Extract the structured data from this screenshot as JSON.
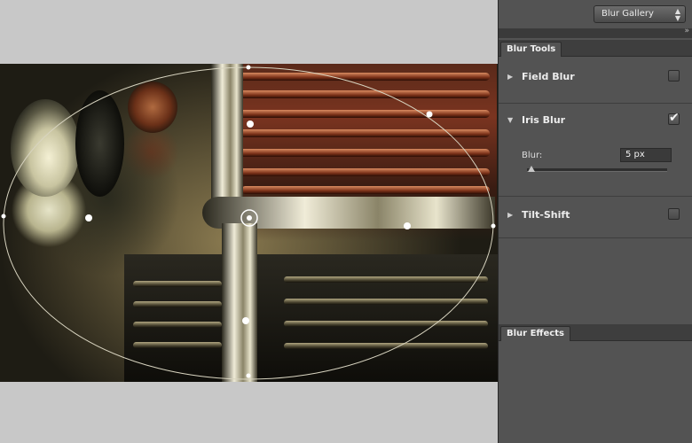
{
  "canvas": {
    "background": "#c8c8c8",
    "iris_overlay": {
      "stroke": "#d8d4c0",
      "handle_color": "#ffffff"
    }
  },
  "header": {
    "workspace_dropdown": {
      "value": "Blur Gallery",
      "caret_icon": "chevron-down-icon"
    },
    "collapse_icon": "double-chevron-right-icon"
  },
  "blur_tools": {
    "tab_label": "Blur Tools",
    "sections": [
      {
        "label": "Field Blur",
        "expanded": false,
        "checked": false
      },
      {
        "label": "Iris Blur",
        "expanded": true,
        "checked": true,
        "blur_label": "Blur:",
        "blur_value": "5 px",
        "slider_level": 0.03
      },
      {
        "label": "Tilt-Shift",
        "expanded": false,
        "checked": false
      }
    ]
  },
  "blur_effects": {
    "tab_label": "Blur Effects"
  },
  "colors": {
    "panel_bg": "#535353",
    "tab_bg": "#3e3e3e",
    "text": "#ececec"
  }
}
